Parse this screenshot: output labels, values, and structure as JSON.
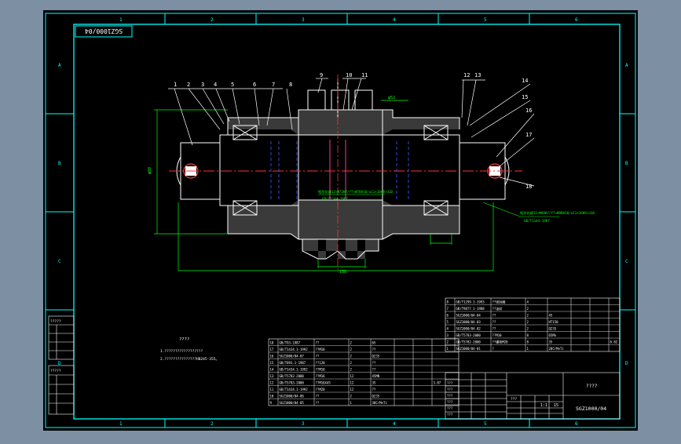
{
  "colors": {
    "viewport_bg": "#7d8fa3",
    "paper": "#000000",
    "frame": "#00ffff",
    "cut_line": "#ffffff",
    "section_fill": "#3a3a3a",
    "center_line": "#ff3030",
    "hidden_line": "#3050ff",
    "dimension": "#00ff00",
    "table_text": "#ffffff",
    "leader_text": "#00ffff"
  },
  "drawing_number_box": "SGZ1000/04",
  "zone_columns": {
    "top": [
      "1",
      "2",
      "3",
      "4",
      "5",
      "6"
    ],
    "bottom": [
      "1",
      "2",
      "3",
      "4",
      "5",
      "6"
    ]
  },
  "zone_rows": {
    "left": [
      "A",
      "B",
      "C",
      "D"
    ],
    "right": [
      "A",
      "B",
      "C",
      "D"
    ]
  },
  "part_callouts": [
    "1",
    "2",
    "3",
    "4",
    "5",
    "6",
    "7",
    "8",
    "9",
    "10",
    "11",
    "12",
    "13",
    "14",
    "15",
    "16",
    "17",
    "18"
  ],
  "dimensions": {
    "overall_height": "φ80",
    "width_shoulder": "φ52",
    "width_bottom": "138",
    "keyway_note": "Ф6H7/c6",
    "right_end": "φ0"
  },
  "fit_annotations": {
    "center_line1": "矩形花键12×Ф72H7/f7×Ф78H10/a11×10H9/d10",
    "center_line2": "GB/T1144-1987",
    "right_line1": "矩形花键12×Ф88H7/f7×Ф98H10/a11×16H9/d10",
    "right_line2": "GB/T1144-1987"
  },
  "technical_requirements": {
    "title": "????",
    "line1": "1.??????????????????",
    "line2": "2.???????????????HB245-355。"
  },
  "left_side_tables": {
    "upper": [
      "?????",
      "",
      "",
      "",
      ""
    ],
    "lower": [
      "?????",
      "",
      "",
      "",
      ""
    ]
  },
  "bom_lower": [
    {
      "code": "18",
      "name": "GB/T93-1987",
      "desc": "??",
      "qty": "2",
      "mat": "65",
      "note": ""
    },
    {
      "code": "17",
      "name": "GB/T1434.1-1992",
      "desc": "??M10",
      "qty": "2",
      "mat": "??",
      "note": ""
    },
    {
      "code": "16",
      "name": "SGZ1000/04-07",
      "desc": "??",
      "qty": "2",
      "mat": "Q235",
      "note": ""
    },
    {
      "code": "15",
      "name": "GB/T893.1-1987",
      "desc": "??120",
      "qty": "2",
      "mat": "??",
      "note": ""
    },
    {
      "code": "14",
      "name": "GB/T1434.1-1992",
      "desc": "??M10",
      "qty": "2",
      "mat": "??",
      "note": ""
    },
    {
      "code": "13",
      "name": "GB/T5782-2000",
      "desc": "??M16",
      "qty": "12",
      "mat": "45MN",
      "note": ""
    },
    {
      "code": "12",
      "name": "GB/T5783-2000",
      "desc": "??M16X45",
      "qty": "12",
      "mat": "35",
      "note": "3.87"
    },
    {
      "code": "11",
      "name": "GB/T1434.1-1992",
      "desc": "??M20",
      "qty": "12",
      "mat": "??",
      "note": ""
    },
    {
      "code": "10",
      "name": "SGZ1000/04-06",
      "desc": "??",
      "qty": "2",
      "mat": "Q235",
      "note": ""
    },
    {
      "code": "9",
      "name": "SGZ1000/04-05",
      "desc": "??",
      "qty": "1",
      "mat": "38CrMnTi",
      "note": ""
    }
  ],
  "bom_upper": [
    {
      "code": "8",
      "name": "GB/T1299.1-1993",
      "desc": "??密封圈",
      "qty": "4",
      "mat": "",
      "note": ""
    },
    {
      "code": "7",
      "name": "GB/T9877.1-1988",
      "desc": "??油封",
      "qty": "2",
      "mat": "",
      "note": ""
    },
    {
      "code": "6",
      "name": "SGZ1000/04-04",
      "desc": "??",
      "qty": "2",
      "mat": "45",
      "note": ""
    },
    {
      "code": "5",
      "name": "SGZ1000/04-03",
      "desc": "??",
      "qty": "2",
      "mat": "HT150",
      "note": ""
    },
    {
      "code": "4",
      "name": "SGZ1000/04-02",
      "desc": "??",
      "qty": "2",
      "mat": "Q235",
      "note": ""
    },
    {
      "code": "3",
      "name": "GB/T5783-2000",
      "desc": "??M10",
      "qty": "8",
      "mat": "65Mn",
      "note": ""
    },
    {
      "code": "2",
      "name": "GB/T5782-2000",
      "desc": "??螺栓M20",
      "qty": "8",
      "mat": "35",
      "note": "8.82"
    },
    {
      "code": "1",
      "name": "SGZ1000/04-01",
      "desc": "?",
      "qty": "1",
      "mat": "20CrMnTi",
      "note": ""
    }
  ],
  "bom_header": {
    "code": "??",
    "name": "??",
    "desc": "??",
    "qty": "??",
    "mat": "??",
    "c1": "??",
    "c2": "??",
    "note": "??"
  },
  "title_block": {
    "title": "????",
    "drawing_no": "SGZ1000/04",
    "scale_label": "1:1",
    "weight": "15",
    "sheet": "???",
    "rows": [
      "???",
      "???",
      "???",
      "???",
      "???",
      "???"
    ]
  }
}
